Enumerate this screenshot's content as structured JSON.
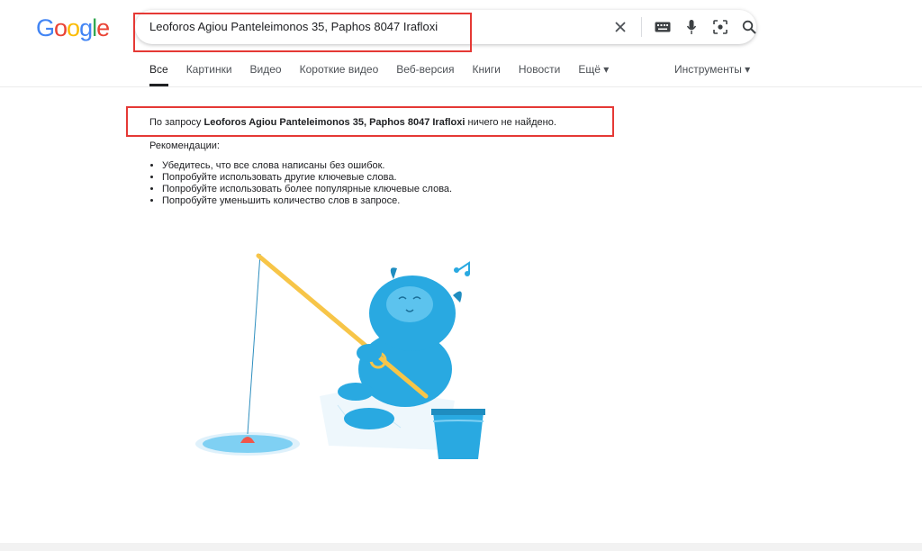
{
  "logo": {
    "letters": [
      "G",
      "o",
      "o",
      "g",
      "l",
      "e"
    ],
    "colors": [
      "#4285F4",
      "#EA4335",
      "#FBBC05",
      "#4285F4",
      "#34A853",
      "#EA4335"
    ]
  },
  "search": {
    "query": "Leoforos Agiou Panteleimonos 35, Paphos 8047 Irafloxi"
  },
  "search_icons": [
    "clear-icon",
    "keyboard-icon",
    "microphone-icon",
    "lens-icon",
    "search-icon"
  ],
  "tabs": [
    {
      "label": "Все",
      "active": true
    },
    {
      "label": "Картинки"
    },
    {
      "label": "Видео"
    },
    {
      "label": "Короткие видео"
    },
    {
      "label": "Веб-версия"
    },
    {
      "label": "Книги"
    },
    {
      "label": "Новости"
    },
    {
      "label": "Ещё ▾"
    }
  ],
  "tools_label": "Инструменты ▾",
  "result": {
    "prefix": "По запросу ",
    "query": "Leoforos Agiou Panteleimonos 35, Paphos 8047 Irafloxi",
    "suffix": " ничего не найдено."
  },
  "recommendations": {
    "title": "Рекомендации:",
    "items": [
      "Убедитесь, что все слова написаны без ошибок.",
      "Попробуйте использовать другие ключевые слова.",
      "Попробуйте использовать более популярные ключевые слова.",
      "Попробуйте уменьшить количество слов в запросе."
    ]
  },
  "colors": {
    "highlight": "#e53935",
    "accent": "#29a9e1"
  }
}
